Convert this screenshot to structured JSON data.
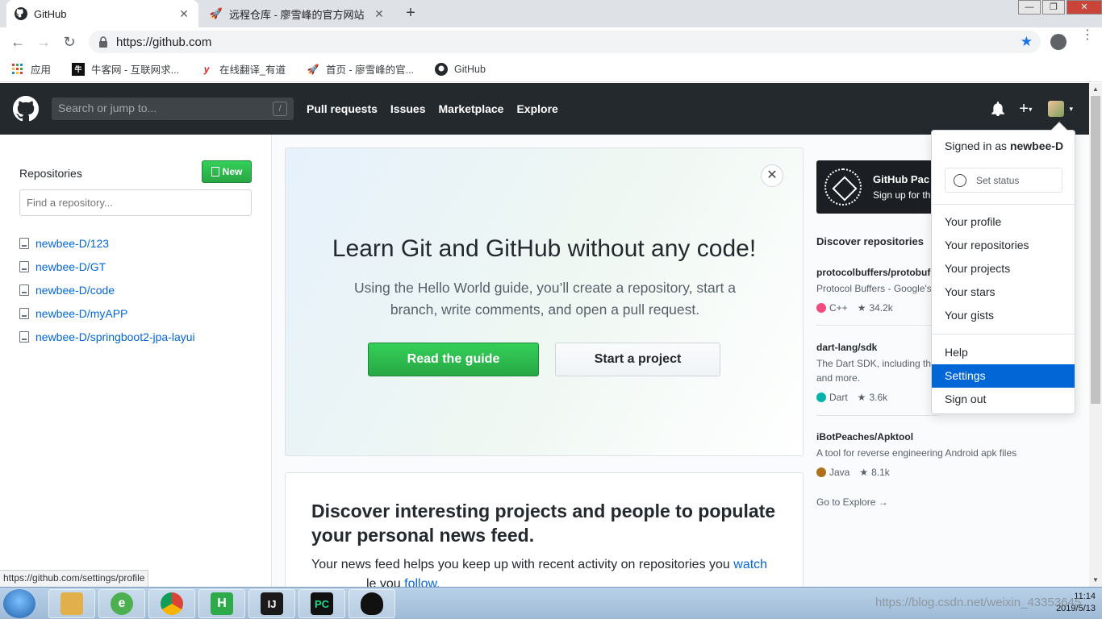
{
  "browser": {
    "tabs": [
      {
        "title": "GitHub",
        "active": true
      },
      {
        "title": "远程仓库 - 廖雪峰的官方网站",
        "active": false
      }
    ],
    "new_tab": "+",
    "url": "https://github.com",
    "bookmarks": [
      {
        "label": "应用",
        "icon": "apps-grid-icon"
      },
      {
        "label": "牛客网 - 互联网求...",
        "icon": "nowcoder-icon"
      },
      {
        "label": "在线翻译_有道",
        "icon": "youdao-icon"
      },
      {
        "label": "首页 - 廖雪峰的官...",
        "icon": "rocket-icon"
      },
      {
        "label": "GitHub",
        "icon": "github-icon"
      }
    ],
    "status_url": "https://github.com/settings/profile"
  },
  "github": {
    "search_placeholder": "Search or jump to...",
    "search_key": "/",
    "nav": [
      "Pull requests",
      "Issues",
      "Marketplace",
      "Explore"
    ],
    "sidebar": {
      "title": "Repositories",
      "new_label": "New",
      "find_placeholder": "Find a repository...",
      "repos": [
        "newbee-D/123",
        "newbee-D/GT",
        "newbee-D/code",
        "newbee-D/myAPP",
        "newbee-D/springboot2-jpa-layui"
      ]
    },
    "hero": {
      "close": "✕",
      "title": "Learn Git and GitHub without any code!",
      "text": "Using the Hello World guide, you’ll create a repository, start a branch, write comments, and open a pull request.",
      "primary": "Read the guide",
      "secondary": "Start a project"
    },
    "discover_card": {
      "title": "Discover interesting projects and people to populate your personal news feed.",
      "text_a": "Your news feed helps you keep up with recent activity on repositories you ",
      "link_a": "watch",
      "text_b": "le you ",
      "link_b": "follow."
    },
    "promo": {
      "title": "GitHub Pac",
      "subtitle": "Sign up for th"
    },
    "discover": {
      "title": "Discover repositories",
      "repos": [
        {
          "name": "protocolbuffers/protobuf",
          "desc": "Protocol Buffers - Google's",
          "lang": "C++",
          "lang_color": "#f34b7d",
          "stars": "34.2k"
        },
        {
          "name": "dart-lang/sdk",
          "desc": "The Dart SDK, including the",
          "desc2": "and more.",
          "lang": "Dart",
          "lang_color": "#00B4AB",
          "stars": "3.6k"
        },
        {
          "name": "iBotPeaches/Apktool",
          "desc": "A tool for reverse engineering Android apk files",
          "lang": "Java",
          "lang_color": "#b07219",
          "stars": "8.1k"
        }
      ],
      "explore_link": "Go to Explore →"
    },
    "dropdown": {
      "signed_prefix": "Signed in as ",
      "username": "newbee-D",
      "set_status": "Set status",
      "items_a": [
        "Your profile",
        "Your repositories",
        "Your projects",
        "Your stars",
        "Your gists"
      ],
      "items_b": [
        "Help",
        "Settings",
        "Sign out"
      ],
      "active": "Settings"
    }
  },
  "taskbar": {
    "apps": [
      {
        "name": "explorer",
        "letter": "",
        "color": "#e2b04a"
      },
      {
        "name": "360-browser",
        "letter": "e",
        "color": "#4caf50"
      },
      {
        "name": "chrome",
        "letter": "",
        "color": "#db4437"
      },
      {
        "name": "hbuilder",
        "letter": "H",
        "color": "#2faa4a"
      },
      {
        "name": "intellij",
        "letter": "IJ",
        "color": "#1a1a1a"
      },
      {
        "name": "pycharm",
        "letter": "PC",
        "color": "#21d789"
      },
      {
        "name": "qq",
        "letter": "",
        "color": "#111"
      }
    ],
    "time": "11:14",
    "date": "2019/5/13",
    "watermark": "https://blog.csdn.net/weixin_43353645"
  }
}
